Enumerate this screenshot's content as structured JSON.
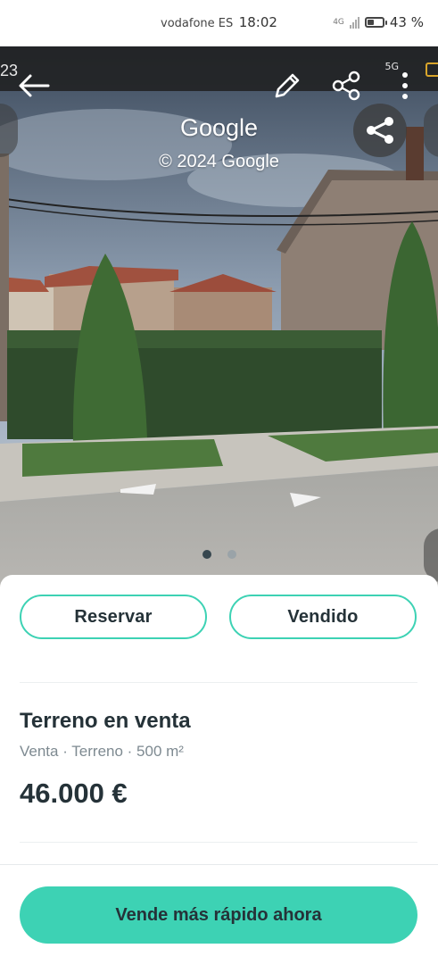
{
  "status_bar": {
    "carrier": "vodafone ES",
    "time": "18:02",
    "network": "4G",
    "battery_percent": "43 %",
    "battery_level": 0.43
  },
  "photo": {
    "inner_status_left": "23",
    "inner_status_network": "5G",
    "watermark_title": "Google",
    "watermark_copyright": "© 2024 Google",
    "current_slide": 1,
    "total_slides": 2
  },
  "toolbar": {
    "back_icon": "arrow-left-icon",
    "edit_icon": "pencil-icon",
    "share_icon": "share-icon",
    "more_icon": "more-vertical-icon"
  },
  "actions": {
    "reserve_label": "Reservar",
    "sold_label": "Vendido"
  },
  "listing": {
    "title": "Terreno en venta",
    "meta": "Venta · Terreno · 500 m²",
    "price": "46.000 €"
  },
  "cta": {
    "label": "Vende más rápido ahora"
  },
  "colors": {
    "accent": "#3dd2b4",
    "text_dark": "#253238",
    "text_muted": "#7e8a91"
  }
}
